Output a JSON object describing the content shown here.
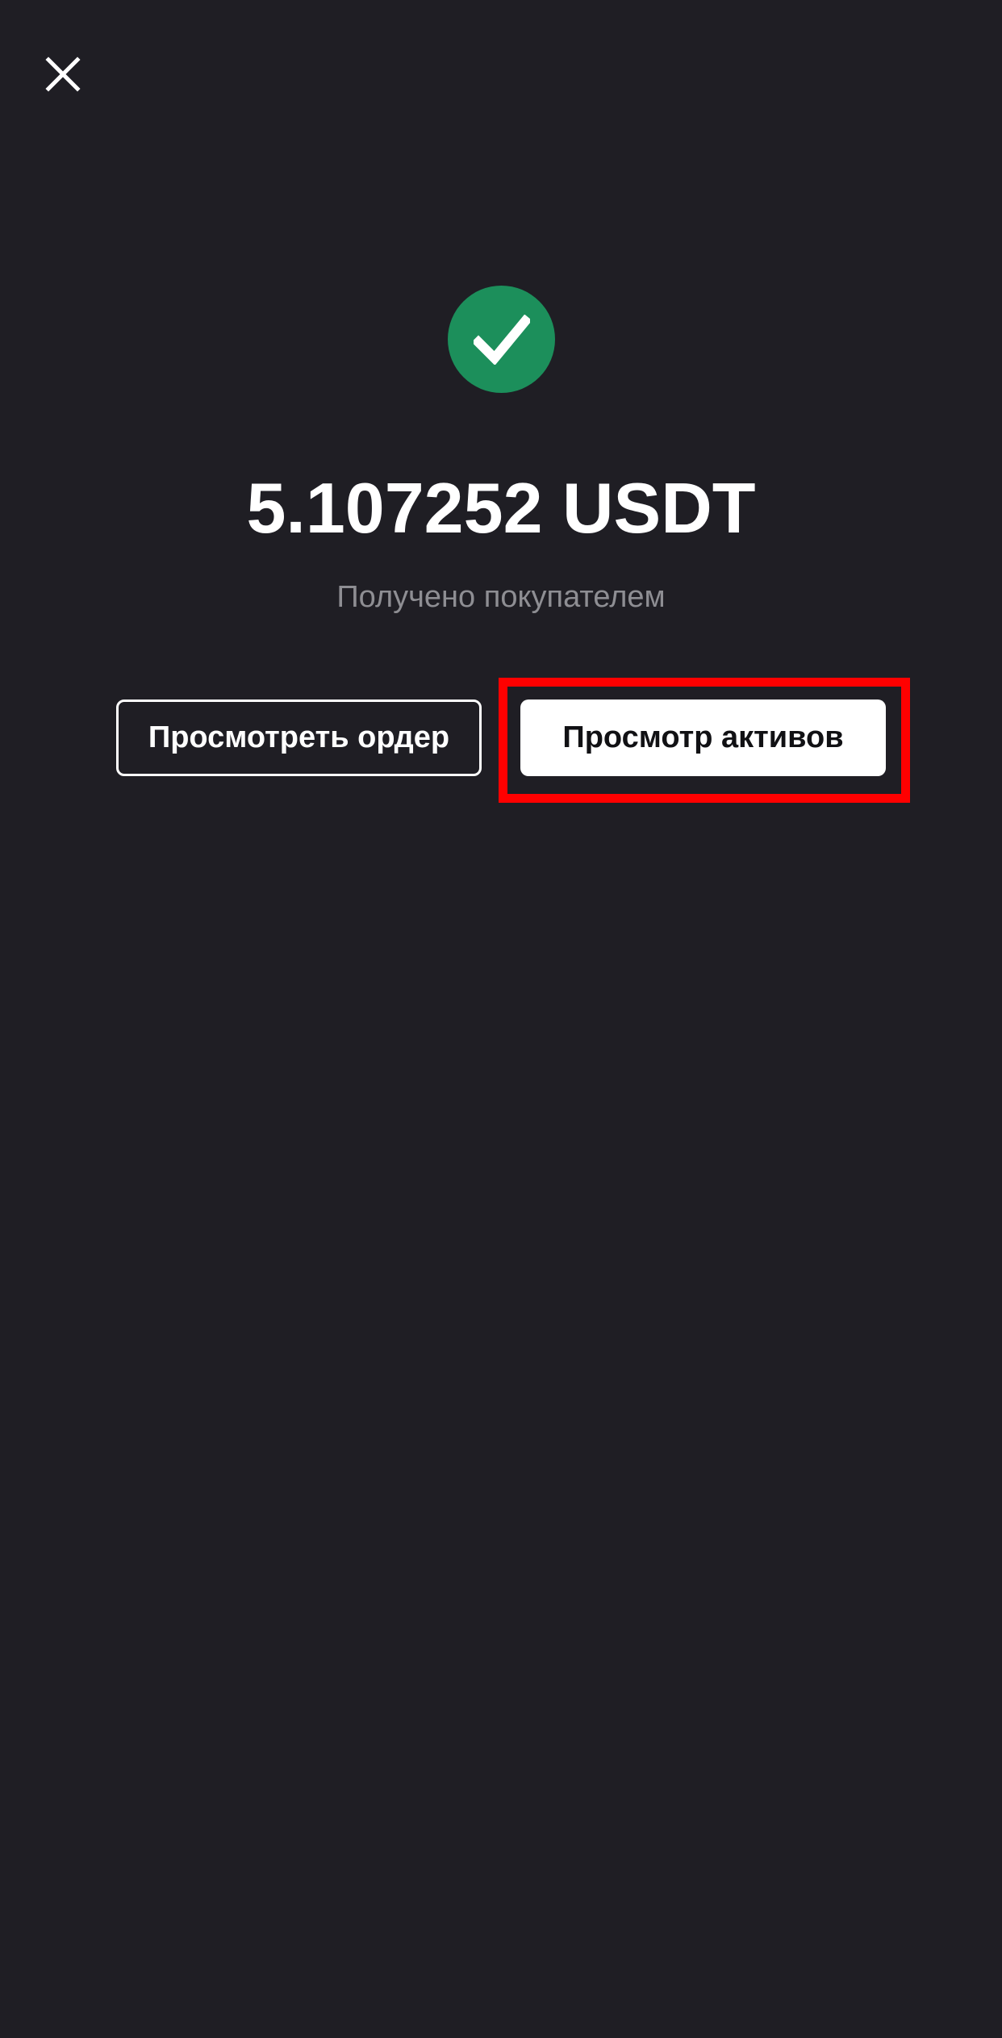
{
  "header": {
    "close_icon": "close-icon"
  },
  "status": {
    "icon": "checkmark-icon",
    "icon_color": "#1c8f5b",
    "amount": "5.107252 USDT",
    "description": "Получено покупателем"
  },
  "actions": {
    "view_order_label": "Просмотреть ордер",
    "view_assets_label": "Просмотр активов"
  },
  "colors": {
    "background": "#1f1e24",
    "highlight": "#ff0000"
  }
}
